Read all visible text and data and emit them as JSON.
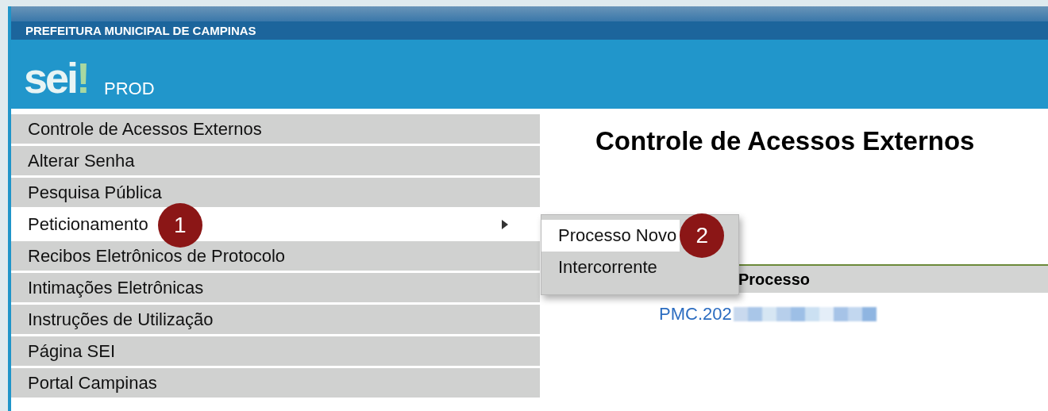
{
  "header": {
    "organization": "PREFEITURA MUNICIPAL DE CAMPINAS",
    "logo": {
      "text": "sei",
      "mark": "!"
    },
    "environment": "PROD"
  },
  "sidebar": {
    "items": [
      {
        "label": "Controle de Acessos Externos",
        "selected": false
      },
      {
        "label": "Alterar Senha",
        "selected": false
      },
      {
        "label": "Pesquisa Pública",
        "selected": false
      },
      {
        "label": "Peticionamento",
        "selected": true,
        "has_submenu": true,
        "badge": "1"
      },
      {
        "label": "Recibos Eletrônicos de Protocolo",
        "selected": false
      },
      {
        "label": "Intimações Eletrônicas",
        "selected": false
      },
      {
        "label": "Instruções de Utilização",
        "selected": false
      },
      {
        "label": "Página SEI",
        "selected": false
      },
      {
        "label": "Portal Campinas",
        "selected": false
      }
    ]
  },
  "submenu": {
    "items": [
      {
        "label": "Processo Novo",
        "selected": true,
        "badge": "2"
      },
      {
        "label": "Intercorrente",
        "selected": false
      }
    ]
  },
  "main": {
    "title": "Controle de Acessos Externos",
    "table": {
      "columns": [
        "Processo"
      ],
      "rows": [
        {
          "process": "PMC.202",
          "redacted": true
        }
      ]
    }
  }
}
